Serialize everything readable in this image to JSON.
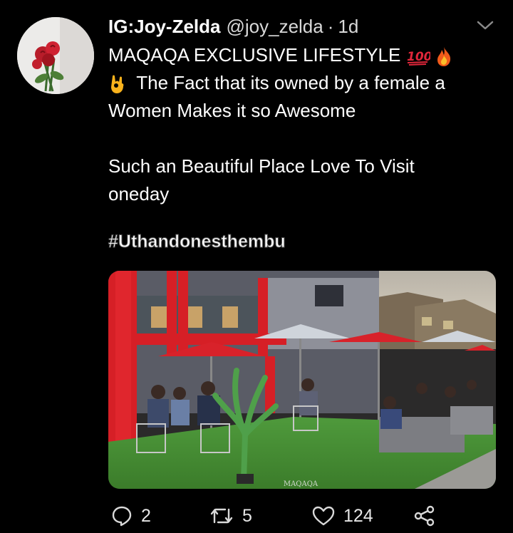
{
  "tweet": {
    "display_name": "IG:Joy-Zelda",
    "handle": "@joy_zelda",
    "separator": "·",
    "time": "1d",
    "lines": {
      "l1": "MAQAQA EXCLUSIVE LIFESTYLE",
      "l2": "The Fact that its owned by a female a",
      "l3": "Women Makes it so Awesome",
      "l4": "Such an Beautiful Place Love To Visit",
      "l5": "oneday"
    },
    "hashtag": "#Uthandonesthembu",
    "photo_watermark": "MAQAQA",
    "emojis": [
      "hundred-points-icon",
      "fire-icon",
      "ok-hand-icon"
    ]
  },
  "actions": {
    "reply_count": "2",
    "retweet_count": "5",
    "like_count": "124"
  },
  "colors": {
    "background": "#000000",
    "text": "#ffffff",
    "secondary_text": "#d9d9d9",
    "icon": "#d9d9d9"
  }
}
